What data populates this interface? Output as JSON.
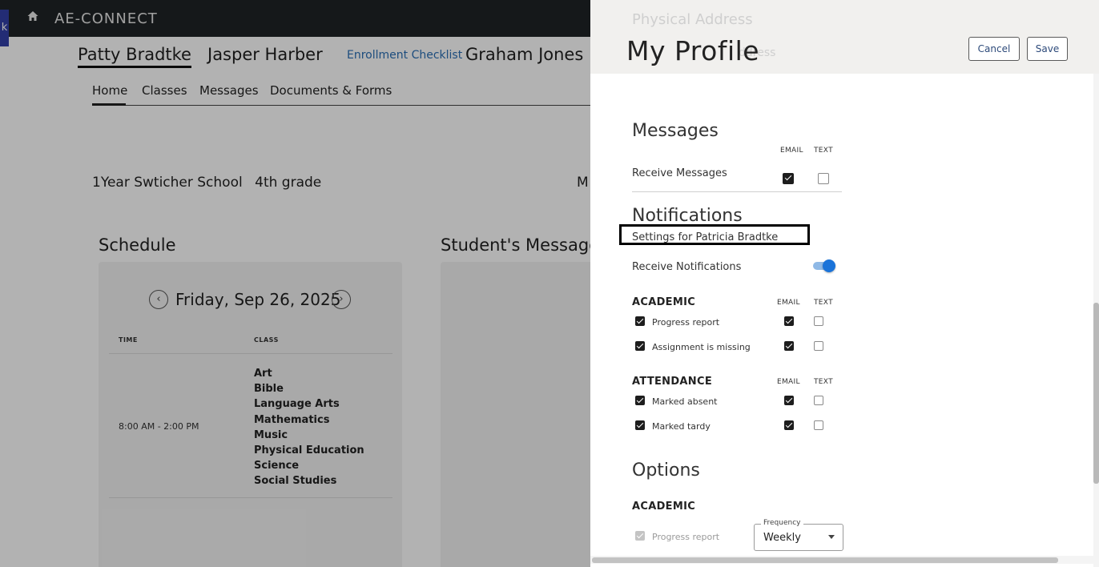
{
  "app": {
    "brand": "AE-CONNECT",
    "edge_tab": "k"
  },
  "students": {
    "items": [
      {
        "name": "Patty Bradtke",
        "active": true
      },
      {
        "name": "Jasper Harber",
        "active": false
      },
      {
        "name": "Graham Jones",
        "active": false
      }
    ],
    "enrollment_link": "Enrollment Checklist"
  },
  "subnav": {
    "tabs": [
      "Home",
      "Classes",
      "Messages",
      "Documents & Forms"
    ]
  },
  "school": {
    "name": "1Year Swticher School",
    "grade": "4th grade",
    "cut_text": "M"
  },
  "schedule": {
    "title": "Schedule",
    "date": "Friday, Sep 26, 2025",
    "col_time": "TIME",
    "col_class": "CLASS",
    "time": "8:00 AM - 2:00 PM",
    "classes": [
      "Art",
      "Bible",
      "Language Arts",
      "Mathematics",
      "Music",
      "Physical Education",
      "Science",
      "Social Studies"
    ]
  },
  "student_messages": {
    "title": "Student's Messages"
  },
  "drawer": {
    "title": "My Profile",
    "ghost_physical": "Physical Address",
    "ghost_address": "ddress",
    "cancel": "Cancel",
    "save": "Save",
    "messages": {
      "title": "Messages",
      "col_email": "EMAIL",
      "col_text": "TEXT",
      "row_label": "Receive Messages",
      "email": true,
      "text": false
    },
    "notifications": {
      "title": "Notifications",
      "settings_for": "Settings for Patricia Bradtke",
      "receive_label": "Receive Notifications",
      "receive_on": true,
      "academic": {
        "title": "ACADEMIC",
        "col_email": "EMAIL",
        "col_text": "TEXT",
        "rows": [
          {
            "label": "Progress report",
            "enabled": true,
            "email": true,
            "text": false
          },
          {
            "label": "Assignment is missing",
            "enabled": true,
            "email": true,
            "text": false
          }
        ]
      },
      "attendance": {
        "title": "ATTENDANCE",
        "col_email": "EMAIL",
        "col_text": "TEXT",
        "rows": [
          {
            "label": "Marked absent",
            "enabled": true,
            "email": true,
            "text": false
          },
          {
            "label": "Marked tardy",
            "enabled": true,
            "email": true,
            "text": false
          }
        ]
      }
    },
    "options": {
      "title": "Options",
      "academic_title": "ACADEMIC",
      "row_label": "Progress report",
      "frequency_label": "Frequency",
      "frequency_value": "Weekly"
    }
  }
}
